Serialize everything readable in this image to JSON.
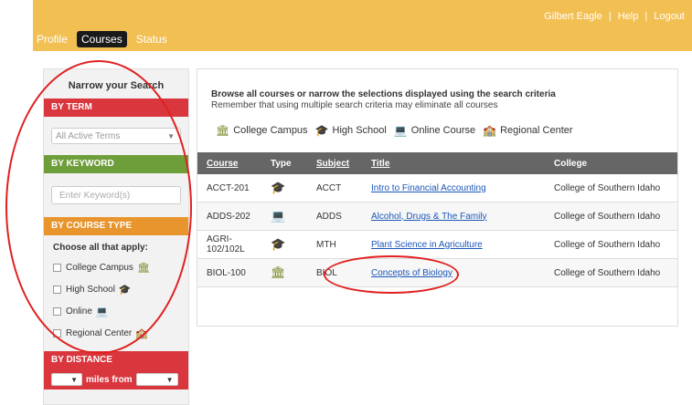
{
  "header": {
    "user": "Gilbert Eagle",
    "help": "Help",
    "logout": "Logout",
    "separator": "|",
    "tabs": [
      {
        "label": "Profile",
        "active": false
      },
      {
        "label": "Courses",
        "active": true
      },
      {
        "label": "Status",
        "active": false
      }
    ]
  },
  "sidebar": {
    "title": "Narrow your Search",
    "by_term": "BY TERM",
    "term_select": "All Active Terms",
    "by_keyword": "BY KEYWORD",
    "keyword_placeholder": "Enter Keyword(s)",
    "by_course_type": "BY COURSE TYPE",
    "choose": "Choose all that apply:",
    "types": [
      {
        "label": "College Campus",
        "icon": "building-icon"
      },
      {
        "label": "High School",
        "icon": "graduation-cap-icon"
      },
      {
        "label": "Online",
        "icon": "laptop-icon"
      },
      {
        "label": "Regional Center",
        "icon": "regional-center-icon"
      }
    ],
    "by_distance": "BY DISTANCE",
    "miles_from": "miles from"
  },
  "main": {
    "heading": "Browse all courses or narrow the selections displayed using the search criteria",
    "subheading": "Remember that using multiple search criteria may eliminate all courses",
    "legend": [
      {
        "label": "College Campus",
        "icon": "building-icon"
      },
      {
        "label": "High School",
        "icon": "graduation-cap-icon"
      },
      {
        "label": "Online Course",
        "icon": "laptop-icon"
      },
      {
        "label": "Regional Center",
        "icon": "regional-center-icon"
      }
    ],
    "columns": [
      "Course",
      "Type",
      "Subject",
      "Title",
      "College"
    ],
    "rows": [
      {
        "course": "ACCT-201",
        "type": "High School",
        "subject": "ACCT",
        "title": "Intro to Financial Accounting",
        "college": "College of Southern Idaho"
      },
      {
        "course": "ADDS-202",
        "type": "Online",
        "subject": "ADDS",
        "title": "Alcohol, Drugs & The Family",
        "college": "College of Southern Idaho"
      },
      {
        "course": "AGRI-102/102L",
        "type": "High School",
        "subject": "MTH",
        "title": "Plant Science in Agriculture",
        "college": "College of Southern Idaho"
      },
      {
        "course": "BIOL-100",
        "type": "College Campus",
        "subject": "BIOL",
        "title": "Concepts of Biology",
        "college": "College of Southern Idaho"
      }
    ]
  },
  "colors": {
    "topbar": "#f2bf53",
    "term_header": "#d9363e",
    "keyword_header": "#6e9e3a",
    "course_type_header": "#e8952e",
    "table_header": "#666666",
    "link": "#1a56b8"
  }
}
